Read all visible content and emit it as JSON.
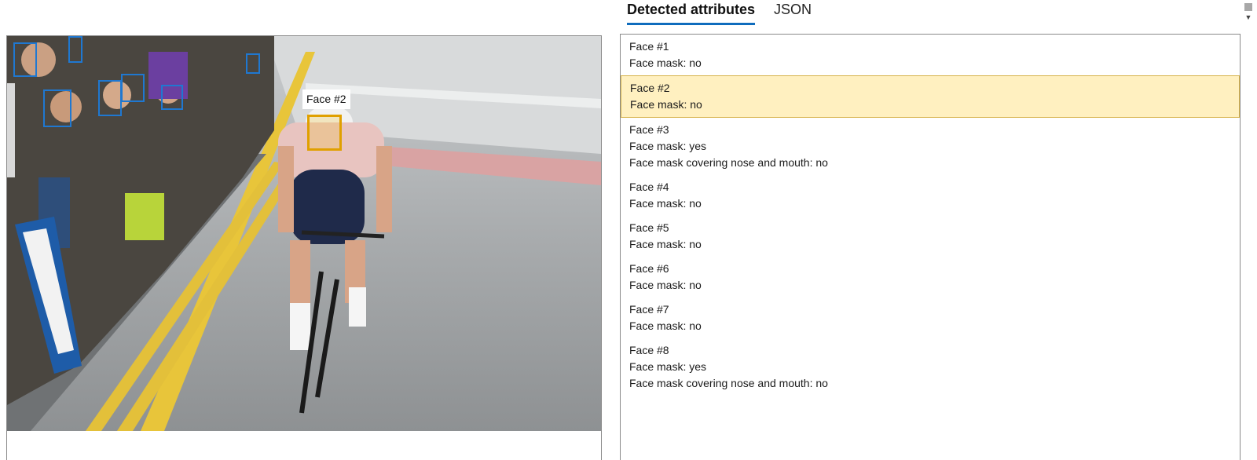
{
  "tabs": [
    {
      "label": "Detected attributes",
      "active": true
    },
    {
      "label": "JSON",
      "active": false
    }
  ],
  "image": {
    "description_icon": "photo",
    "selected_face_label": "Face #2"
  },
  "faces": [
    {
      "title": "Face #1",
      "attributes": [
        "Face mask: no"
      ]
    },
    {
      "title": "Face #2",
      "attributes": [
        "Face mask: no"
      ],
      "selected": true
    },
    {
      "title": "Face #3",
      "attributes": [
        "Face mask: yes",
        "Face mask covering nose and mouth: no"
      ]
    },
    {
      "title": "Face #4",
      "attributes": [
        "Face mask: no"
      ]
    },
    {
      "title": "Face #5",
      "attributes": [
        "Face mask: no"
      ]
    },
    {
      "title": "Face #6",
      "attributes": [
        "Face mask: no"
      ]
    },
    {
      "title": "Face #7",
      "attributes": [
        "Face mask: no"
      ]
    },
    {
      "title": "Face #8",
      "attributes": [
        "Face mask: yes",
        "Face mask covering nose and mouth: no"
      ]
    }
  ],
  "colors": {
    "accent": "#0f6cbd",
    "face_box": "#1f78d1",
    "selected_box": "#e0a000",
    "selected_row": "#fff0c0"
  }
}
